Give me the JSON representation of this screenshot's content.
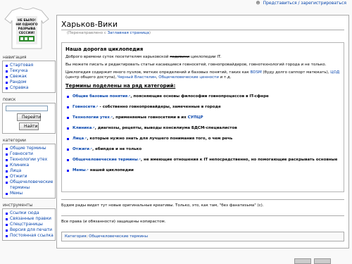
{
  "personal": {
    "link": "Представиться / зарегистрироваться"
  },
  "logo": {
    "line1": "НЕ БЫЛО!",
    "line2": "НИ ОДНОГО",
    "line3": "РАЗРЫВА",
    "line4": "СЕССИИ!"
  },
  "sidebar": {
    "navigation_header": "навигация",
    "navigation_items": [
      "Стартовая",
      "Текучка",
      "Свежак",
      "Рандом",
      "Справка"
    ],
    "search_header": "поиск",
    "search_placeholder": "",
    "go_button": "Перейти",
    "search_button": "Найти",
    "categories_header": "категории",
    "categories_items": [
      "Общие термины",
      "Говносети",
      "Технологии утех",
      "Клиника",
      "Лица",
      "Отжиги",
      "Общечеловеческие термины",
      "Мемы"
    ],
    "tools_header": "инструменты",
    "tools_items": [
      "Ссылки сюда",
      "Связанные правки",
      "Спецстраницы",
      "Версия для печати",
      "Постоянная ссылка"
    ]
  },
  "page": {
    "title": "Харьков-Вики",
    "redirect_prefix": "(Перенаправлено с ",
    "redirect_link": "Заглавная страница",
    "redirect_suffix": ")"
  },
  "intro": {
    "heading": "Наша дорогая циклопедия",
    "p1_before": "Доброго времени суток посетителям харьковской ",
    "p1_strike": "педивики",
    "p1_after": " циклопедии IT.",
    "p2": "Вы можете писать и редактировать статьи касающиеся говносетей, говнопровайдеров, говнотехнологий города и не только.",
    "p3_a": "Циклопедия содержит много пузлов, метких определений и базовых понятий, таких как ",
    "p3_bdsm": "BDSM",
    "p3_b": " (буду долго саппорт матюкать), ",
    "p3_cod": "ЦОД",
    "p3_c": " (центр общего доступа), ",
    "p3_vlastelin": "Черный Властелин",
    "p3_d": ", ",
    "p3_obsch": "Общечеловеческие ценности",
    "p3_e": " и т.д.",
    "categories_heading": "Термины поделены на ряд категорий:"
  },
  "categories": [
    {
      "link": "Общие базовые понятия",
      "desc": ", поясняющие основы философии говнопроцессов в IT-сфере"
    },
    {
      "link": "Говносети",
      "desc": " - собственно говнопровайдеры, замеченные в городе"
    },
    {
      "link": "Технологии утех",
      "desc": ", применяемые говносетями в их ",
      "extra": "СУПЦР"
    },
    {
      "link": "Клиника",
      "desc": ", диагнозы, рецепты, выводы консилиума БДСМ-специалистов"
    },
    {
      "link": "Лица",
      "desc": ", которые нужно знать для лучшего понимания того, о чем речь"
    },
    {
      "link": "Отжиги",
      "desc": ", ебипдов и не только"
    },
    {
      "link": "Общечеловеческие термины",
      "desc": ", не имеющие отношения к IT непосредственно, но помогающие раскрывать основные"
    },
    {
      "link": "Мемы",
      "desc": " нашей циклопедии"
    }
  ],
  "footer_text1": "Будем рады видет тут новые оригинальные креативы. Только, это, как там, \"без фанатизьма\" (с).",
  "footer_text2": "Все права (и обязанности) защищены копирастом.",
  "catlinks": {
    "prefix": "Категория",
    "link": "Общечеловеческие термины"
  },
  "colors": {
    "link": "#0645ad",
    "border": "#aaaaaa",
    "bg": "#f9f9f9"
  }
}
